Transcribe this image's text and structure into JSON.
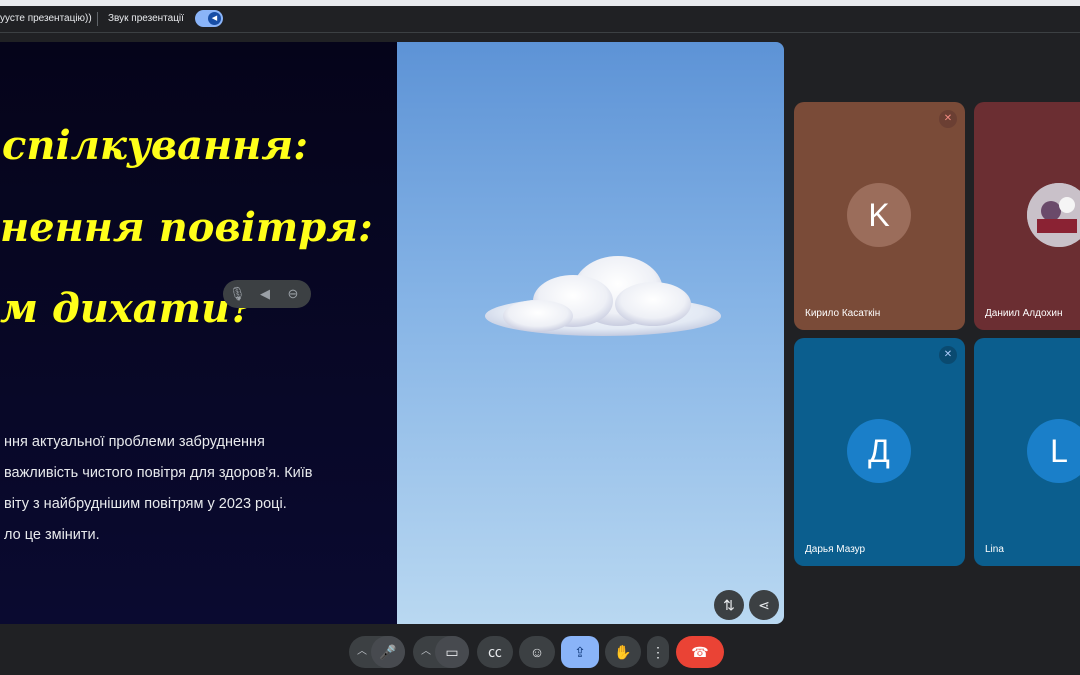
{
  "topbar": {
    "presentation_name": "уусте презентацію))",
    "sound_label": "Звук презентації",
    "sound_toggle_on": true
  },
  "slide": {
    "title_lines": [
      "спілкування:",
      "нення повітря:",
      "м дихати?\""
    ],
    "body_lines": [
      "ння актуальної проблеми забруднення",
      "важливість чистого повітря для здоров'я. Київ",
      "віту з найбруднішим повітрям у 2023 році.",
      "ло це змінити."
    ],
    "title_color": "#ffff1a"
  },
  "participants": [
    {
      "name": "Кирило Касаткін",
      "initial": "K",
      "tile_color": "#7a4b38",
      "avatar_color": "#9b6d5b",
      "muted": true
    },
    {
      "name": "Даниил Алдохин",
      "initial": "",
      "tile_color": "#6b2e32",
      "avatar_color": "#b0a6b0",
      "muted": false
    },
    {
      "name": "Дарья Мазур",
      "initial": "Д",
      "tile_color": "#0b5e8e",
      "avatar_color": "#1a7fc9",
      "muted": true
    },
    {
      "name": "Lina",
      "initial": "L",
      "tile_color": "#0b5e8e",
      "avatar_color": "#1a7fc9",
      "muted": false
    }
  ],
  "controls": {
    "mic": "microphone-icon",
    "camera": "camera-icon",
    "captions": "captions-icon",
    "emoji": "emoji-icon",
    "present": "present-icon",
    "hand": "raise-hand-icon",
    "more": "more-icon",
    "leave": "hang-up-icon",
    "present_active_color": "#8ab4f8",
    "leave_color": "#ea4335"
  }
}
